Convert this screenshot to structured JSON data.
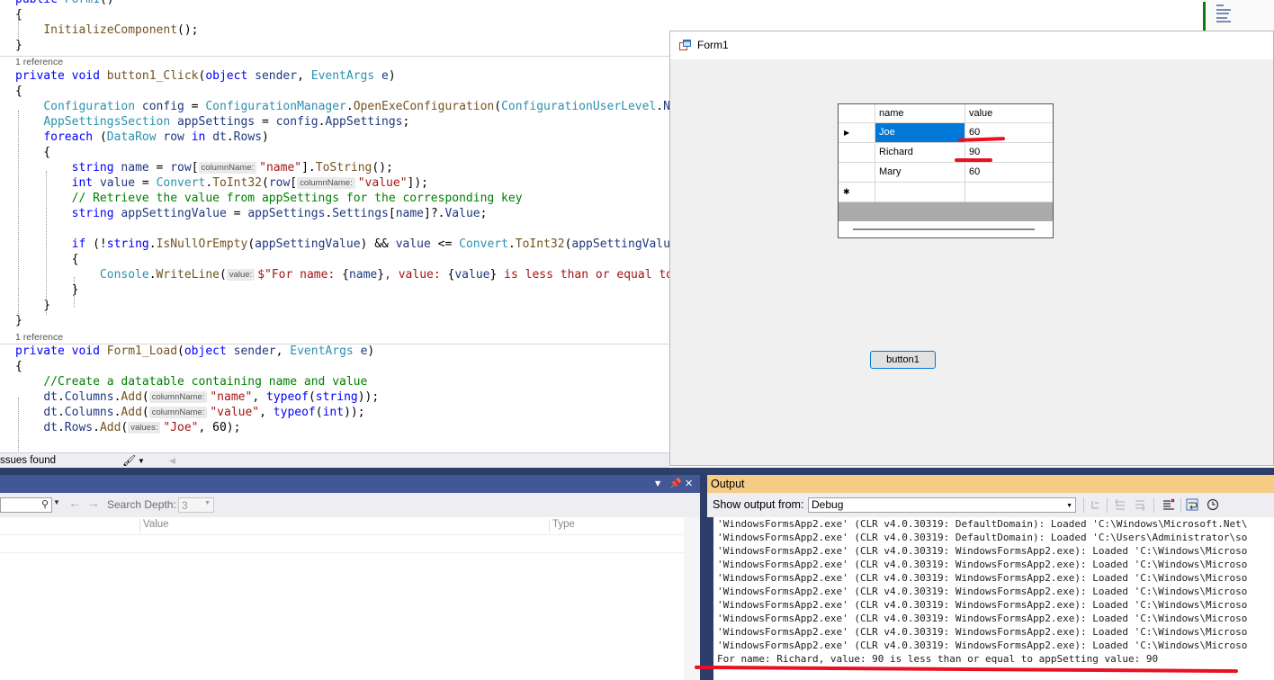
{
  "editor": {
    "lines": [
      [
        [
          "kw",
          "public "
        ],
        [
          "ty",
          "Form1"
        ],
        [
          "",
          "()"
        ]
      ],
      [
        [
          "",
          "{"
        ]
      ],
      [
        [
          "",
          "    "
        ],
        [
          "fn",
          "InitializeComponent"
        ],
        [
          "",
          "();"
        ]
      ],
      [
        [
          "",
          "}"
        ]
      ],
      [
        [
          "",
          "REF"
        ]
      ],
      [
        [
          "kw",
          "private void "
        ],
        [
          "fn",
          "button1_Click"
        ],
        [
          "",
          "("
        ],
        [
          "kw",
          "object "
        ],
        [
          "id",
          "sender"
        ],
        [
          "",
          ", "
        ],
        [
          "ty",
          "EventArgs "
        ],
        [
          "id",
          "e"
        ],
        [
          "",
          ")"
        ]
      ],
      [
        [
          "",
          "{"
        ]
      ],
      [
        [
          "",
          "    "
        ],
        [
          "ty",
          "Configuration "
        ],
        [
          "id",
          "config"
        ],
        [
          "",
          " = "
        ],
        [
          "ty",
          "ConfigurationManager"
        ],
        [
          "",
          "."
        ],
        [
          "fn",
          "OpenExeConfiguration"
        ],
        [
          "",
          "("
        ],
        [
          "ty",
          "ConfigurationUserLevel"
        ],
        [
          "",
          "."
        ],
        [
          "id",
          "None"
        ],
        [
          "",
          ");"
        ]
      ],
      [
        [
          "",
          "    "
        ],
        [
          "ty",
          "AppSettingsSection "
        ],
        [
          "id",
          "appSettings"
        ],
        [
          "",
          " = "
        ],
        [
          "id",
          "config"
        ],
        [
          "",
          "."
        ],
        [
          "id",
          "AppSettings"
        ],
        [
          "",
          ";"
        ]
      ],
      [
        [
          "",
          "    "
        ],
        [
          "kw",
          "foreach "
        ],
        [
          "",
          "("
        ],
        [
          "ty",
          "DataRow "
        ],
        [
          "id",
          "row "
        ],
        [
          "kw",
          "in "
        ],
        [
          "id",
          "dt"
        ],
        [
          "",
          "."
        ],
        [
          "id",
          "Rows"
        ],
        [
          "",
          ")"
        ]
      ],
      [
        [
          "",
          "    {"
        ]
      ],
      [
        [
          "",
          "        "
        ],
        [
          "kw",
          "string "
        ],
        [
          "id",
          "name"
        ],
        [
          "",
          " = "
        ],
        [
          "id",
          "row"
        ],
        [
          "",
          "["
        ],
        [
          "hint",
          "columnName:"
        ],
        [
          "st",
          "\"name\""
        ],
        [
          "",
          "]."
        ],
        [
          "fn",
          "ToString"
        ],
        [
          "",
          "();"
        ]
      ],
      [
        [
          "",
          "        "
        ],
        [
          "kw",
          "int "
        ],
        [
          "id",
          "value"
        ],
        [
          "",
          " = "
        ],
        [
          "ty",
          "Convert"
        ],
        [
          "",
          "."
        ],
        [
          "fn",
          "ToInt32"
        ],
        [
          "",
          "("
        ],
        [
          "id",
          "row"
        ],
        [
          "",
          "["
        ],
        [
          "hint",
          "columnName:"
        ],
        [
          "st",
          "\"value\""
        ],
        [
          "",
          "]);"
        ]
      ],
      [
        [
          "",
          "        "
        ],
        [
          "cm",
          "// Retrieve the value from appSettings for the corresponding key"
        ]
      ],
      [
        [
          "",
          "        "
        ],
        [
          "kw",
          "string "
        ],
        [
          "id",
          "appSettingValue"
        ],
        [
          "",
          " = "
        ],
        [
          "id",
          "appSettings"
        ],
        [
          "",
          "."
        ],
        [
          "id",
          "Settings"
        ],
        [
          "",
          "["
        ],
        [
          "id",
          "name"
        ],
        [
          "",
          "]?."
        ],
        [
          "id",
          "Value"
        ],
        [
          "",
          ";"
        ]
      ],
      [
        [
          "",
          ""
        ]
      ],
      [
        [
          "",
          "        "
        ],
        [
          "kw",
          "if "
        ],
        [
          "",
          "(!"
        ],
        [
          "kw",
          "string"
        ],
        [
          "",
          "."
        ],
        [
          "fn",
          "IsNullOrEmpty"
        ],
        [
          "",
          "("
        ],
        [
          "id",
          "appSettingValue"
        ],
        [
          "",
          ") && "
        ],
        [
          "id",
          "value"
        ],
        [
          "",
          " <= "
        ],
        [
          "ty",
          "Convert"
        ],
        [
          "",
          "."
        ],
        [
          "fn",
          "ToInt32"
        ],
        [
          "",
          "("
        ],
        [
          "id",
          "appSettingValue"
        ],
        [
          "",
          "))"
        ]
      ],
      [
        [
          "",
          "        {"
        ]
      ],
      [
        [
          "",
          "            "
        ],
        [
          "ty",
          "Console"
        ],
        [
          "",
          "."
        ],
        [
          "fn",
          "WriteLine"
        ],
        [
          "",
          "("
        ],
        [
          "hint",
          "value:"
        ],
        [
          "st",
          "$\"For name: "
        ],
        [
          "",
          "{"
        ],
        [
          "id",
          "name"
        ],
        [
          "",
          "}"
        ],
        [
          "st",
          ", value: "
        ],
        [
          "",
          "{"
        ],
        [
          "id",
          "value"
        ],
        [
          "",
          "}"
        ],
        [
          "st",
          " is less than or equal to appSetting value: "
        ],
        [
          "",
          "{"
        ],
        [
          "id",
          "appSettingValue"
        ],
        [
          "",
          "}"
        ],
        [
          "st",
          "\""
        ],
        [
          "",
          ");"
        ]
      ],
      [
        [
          "",
          "        }"
        ]
      ],
      [
        [
          "",
          "    }"
        ]
      ],
      [
        [
          "",
          "}"
        ]
      ],
      [
        [
          "",
          "REF"
        ]
      ],
      [
        [
          "kw",
          "private void "
        ],
        [
          "fn",
          "Form1_Load"
        ],
        [
          "",
          "("
        ],
        [
          "kw",
          "object "
        ],
        [
          "id",
          "sender"
        ],
        [
          "",
          ", "
        ],
        [
          "ty",
          "EventArgs "
        ],
        [
          "id",
          "e"
        ],
        [
          "",
          ")"
        ]
      ],
      [
        [
          "",
          "{"
        ]
      ],
      [
        [
          "",
          "    "
        ],
        [
          "cm",
          "//Create a datatable containing name and value"
        ]
      ],
      [
        [
          "",
          "    "
        ],
        [
          "id",
          "dt"
        ],
        [
          "",
          "."
        ],
        [
          "id",
          "Columns"
        ],
        [
          "",
          "."
        ],
        [
          "fn",
          "Add"
        ],
        [
          "",
          "("
        ],
        [
          "hint",
          "columnName:"
        ],
        [
          "st",
          "\"name\""
        ],
        [
          "",
          ", "
        ],
        [
          "kw",
          "typeof"
        ],
        [
          "",
          "("
        ],
        [
          "kw",
          "string"
        ],
        [
          "",
          "));"
        ]
      ],
      [
        [
          "",
          "    "
        ],
        [
          "id",
          "dt"
        ],
        [
          "",
          "."
        ],
        [
          "id",
          "Columns"
        ],
        [
          "",
          "."
        ],
        [
          "fn",
          "Add"
        ],
        [
          "",
          "("
        ],
        [
          "hint",
          "columnName:"
        ],
        [
          "st",
          "\"value\""
        ],
        [
          "",
          ", "
        ],
        [
          "kw",
          "typeof"
        ],
        [
          "",
          "("
        ],
        [
          "kw",
          "int"
        ],
        [
          "",
          "));"
        ]
      ],
      [
        [
          "",
          "    "
        ],
        [
          "id",
          "dt"
        ],
        [
          "",
          "."
        ],
        [
          "id",
          "Rows"
        ],
        [
          "",
          "."
        ],
        [
          "fn",
          "Add"
        ],
        [
          "",
          "("
        ],
        [
          "hint",
          "values:"
        ],
        [
          "st",
          "\"Joe\""
        ],
        [
          "",
          ", 60);"
        ]
      ]
    ],
    "reference_label": "1 reference",
    "status_text": "ssues found"
  },
  "form1": {
    "title": "Form1",
    "grid": {
      "columns": [
        "name",
        "value"
      ],
      "rows": [
        [
          "Joe",
          "60"
        ],
        [
          "Richard",
          "90"
        ],
        [
          "Mary",
          "60"
        ]
      ],
      "current_row_marker": "▶",
      "new_row_marker": "✱"
    },
    "button_label": "button1"
  },
  "watch_panel": {
    "search_depth_label": "Search Depth:",
    "search_depth_value": "3",
    "columns": [
      "Value",
      "Type"
    ]
  },
  "output_panel": {
    "title": "Output",
    "show_from_label": "Show output from:",
    "source": "Debug",
    "lines": [
      "'WindowsFormsApp2.exe' (CLR v4.0.30319: DefaultDomain): Loaded 'C:\\Windows\\Microsoft.Net\\",
      "'WindowsFormsApp2.exe' (CLR v4.0.30319: DefaultDomain): Loaded 'C:\\Users\\Administrator\\so",
      "'WindowsFormsApp2.exe' (CLR v4.0.30319: WindowsFormsApp2.exe): Loaded 'C:\\Windows\\Microso",
      "'WindowsFormsApp2.exe' (CLR v4.0.30319: WindowsFormsApp2.exe): Loaded 'C:\\Windows\\Microso",
      "'WindowsFormsApp2.exe' (CLR v4.0.30319: WindowsFormsApp2.exe): Loaded 'C:\\Windows\\Microso",
      "'WindowsFormsApp2.exe' (CLR v4.0.30319: WindowsFormsApp2.exe): Loaded 'C:\\Windows\\Microso",
      "'WindowsFormsApp2.exe' (CLR v4.0.30319: WindowsFormsApp2.exe): Loaded 'C:\\Windows\\Microso",
      "'WindowsFormsApp2.exe' (CLR v4.0.30319: WindowsFormsApp2.exe): Loaded 'C:\\Windows\\Microso",
      "'WindowsFormsApp2.exe' (CLR v4.0.30319: WindowsFormsApp2.exe): Loaded 'C:\\Windows\\Microso",
      "'WindowsFormsApp2.exe' (CLR v4.0.30319: WindowsFormsApp2.exe): Loaded 'C:\\Windows\\Microso",
      "For name: Richard, value: 90 is less than or equal to appSetting value: 90"
    ]
  },
  "colors": {
    "annotation_red": "#e81123",
    "selection_blue": "#0078d7",
    "panel_header_blue": "#425896",
    "output_header": "#f5cc84"
  }
}
